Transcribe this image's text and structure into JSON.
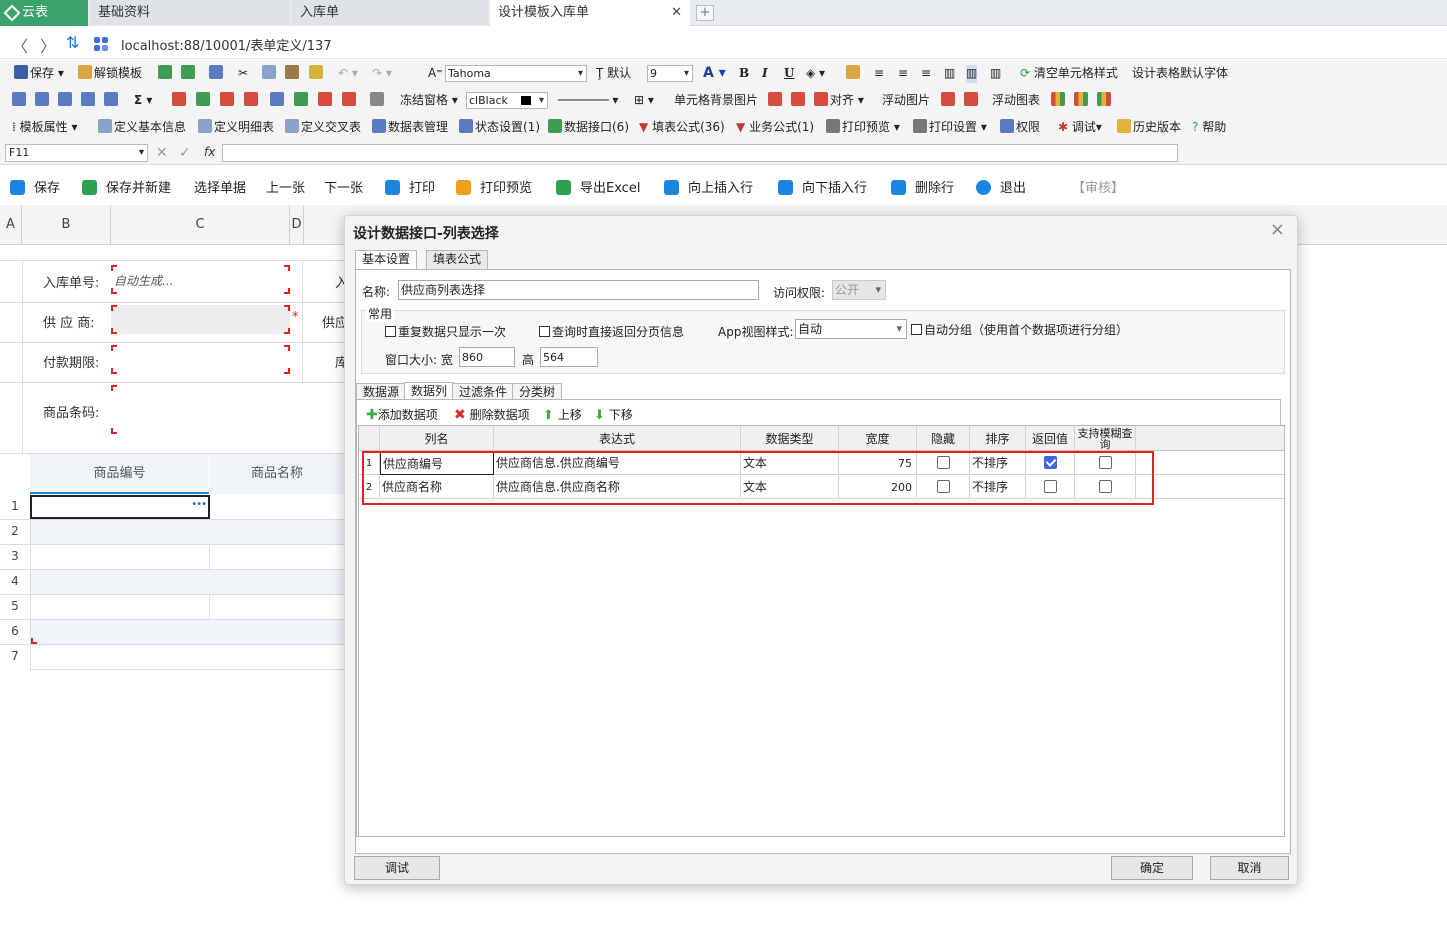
{
  "browser": {
    "tabs": [
      "云表",
      "基础资料",
      "入库单",
      "设计模板入库单"
    ],
    "url": "localhost:88/10001/表单定义/137"
  },
  "toolbar1": {
    "save": "保存",
    "unlock_template": "解锁模板",
    "font_label": "A",
    "font_name": "Tahoma",
    "default_label": "默认",
    "font_size": "9",
    "bold": "B",
    "italic": "I",
    "underline": "U",
    "clear_cell_style": "清空单元格样式",
    "design_default_font": "设计表格默认字体"
  },
  "toolbar2": {
    "sigma": "Σ",
    "freeze": "冻结窗格",
    "color_value": "clBlack",
    "cell_bg_image": "单元格背景图片",
    "align": "对齐",
    "float_image": "浮动图片",
    "float_chart": "浮动图表"
  },
  "toolbar3": {
    "template_props": "模板属性",
    "define_basic": "定义基本信息",
    "define_detail": "定义明细表",
    "define_cross": "定义交叉表",
    "table_mgmt": "数据表管理",
    "status_settings": "状态设置(1)",
    "data_interface": "数据接口(6)",
    "fill_formula": "填表公式(36)",
    "business_formula": "业务公式(1)",
    "print_preview": "打印预览",
    "print_settings": "打印设置",
    "permissions": "权限",
    "debug": "调试",
    "history": "历史版本",
    "help": "帮助"
  },
  "formula_bar": {
    "cell_ref": "F11",
    "fx": "fx"
  },
  "action_bar": {
    "save": "保存",
    "save_new": "保存并新建",
    "select_doc": "选择单据",
    "prev": "上一张",
    "next": "下一张",
    "print": "打印",
    "print_preview": "打印预览",
    "export_excel": "导出Excel",
    "insert_above": "向上插入行",
    "insert_below": "向下插入行",
    "delete_row": "删除行",
    "exit": "退出",
    "audit": "【审核】"
  },
  "sheet": {
    "columns": [
      "A",
      "B",
      "C",
      "D"
    ],
    "labels": [
      "入库单号:",
      "供 应 商:",
      "付款期限:",
      "商品条码:"
    ],
    "right_labels": [
      "入",
      "供应",
      "库"
    ],
    "auto_generate": "自动生成...",
    "required_mark": "*",
    "grid_headers": [
      "商品编号",
      "商品名称"
    ],
    "row_numbers": [
      "1",
      "2",
      "3",
      "4",
      "5",
      "6",
      "7"
    ],
    "ellipsis": "•••"
  },
  "dialog": {
    "title": "设计数据接口-列表选择",
    "close": "×",
    "tabs": [
      "基本设置",
      "填表公式"
    ],
    "name_label": "名称:",
    "name_value": "供应商列表选择",
    "access_label": "访问权限:",
    "access_value": "公开",
    "group_title": "常用",
    "opt_no_repeat": "重复数据只显示一次",
    "opt_return_page": "查询时直接返回分页信息",
    "app_view_label": "App视图样式:",
    "app_view_value": "自动",
    "opt_auto_group": "自动分组（使用首个数据项进行分组）",
    "window_size_label": "窗口大小: 宽",
    "width_value": "860",
    "height_label": "高",
    "height_value": "564",
    "subtabs": [
      "数据源",
      "数据列",
      "过滤条件",
      "分类树"
    ],
    "add_item": "添加数据项",
    "delete_item": "删除数据项",
    "move_up": "上移",
    "move_down": "下移",
    "grid_headers": [
      "列名",
      "表达式",
      "数据类型",
      "宽度",
      "隐藏",
      "排序",
      "返回值",
      "支持模糊查询"
    ],
    "rows": [
      {
        "no": "1",
        "name": "供应商编号",
        "expr": "供应商信息.供应商编号",
        "type": "文本",
        "width": "75",
        "hidden": false,
        "sort": "不排序",
        "return": true,
        "fuzzy": false
      },
      {
        "no": "2",
        "name": "供应商名称",
        "expr": "供应商信息.供应商名称",
        "type": "文本",
        "width": "200",
        "hidden": false,
        "sort": "不排序",
        "return": false,
        "fuzzy": false
      }
    ],
    "debug_btn": "调试",
    "ok_btn": "确定",
    "cancel_btn": "取消"
  }
}
